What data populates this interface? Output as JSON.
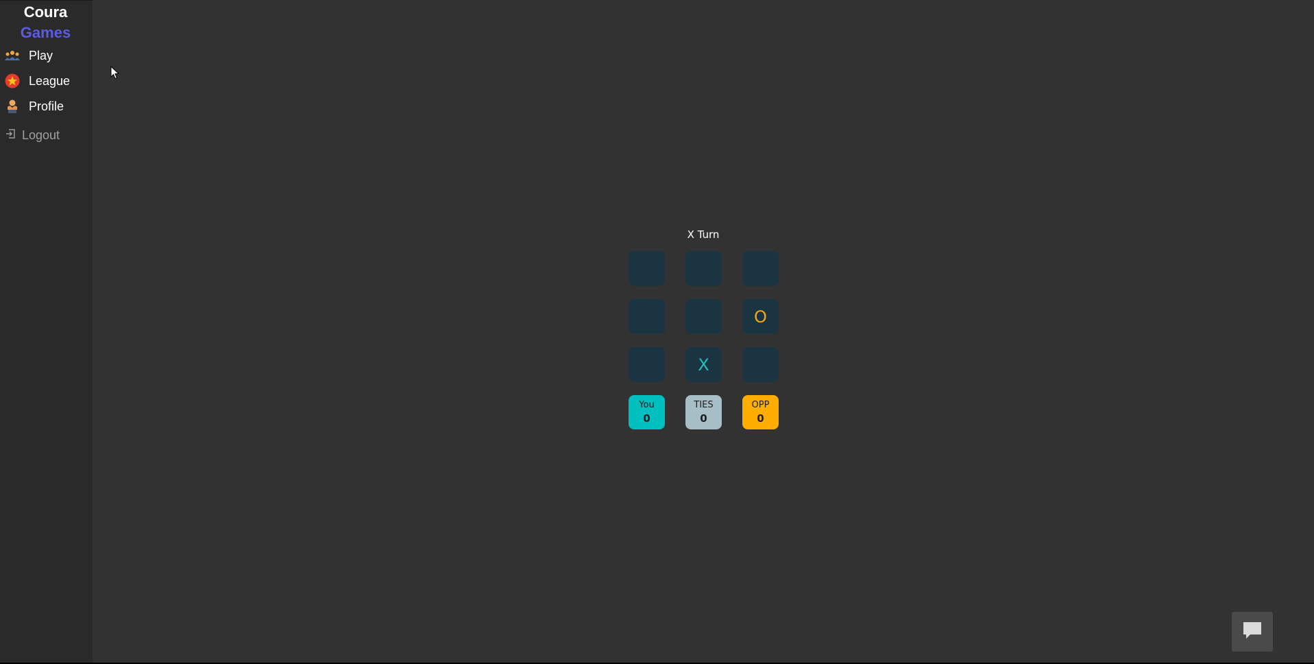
{
  "brand": {
    "line1": "Coura",
    "line2": "Games"
  },
  "nav": {
    "items": [
      {
        "label": "Play",
        "icon": "people-group-icon"
      },
      {
        "label": "League",
        "icon": "star-badge-icon"
      },
      {
        "label": "Profile",
        "icon": "person-icon"
      }
    ],
    "logout": {
      "label": "Logout",
      "icon": "logout-icon"
    }
  },
  "game": {
    "turn_text": "X Turn",
    "board": [
      "",
      "",
      "",
      "",
      "",
      "O",
      "",
      "X",
      ""
    ],
    "scores": [
      {
        "label": "You",
        "value": "0",
        "color": "#00bfbf"
      },
      {
        "label": "TIES",
        "value": "0",
        "color": "#a8bec6"
      },
      {
        "label": "OPP",
        "value": "0",
        "color": "#ffad00"
      }
    ]
  },
  "colors": {
    "x_mark": "#1fc0c0",
    "o_mark": "#f0a814",
    "brand_accent": "#5c5ce0"
  },
  "chat": {
    "icon": "chat-bubble-icon"
  }
}
